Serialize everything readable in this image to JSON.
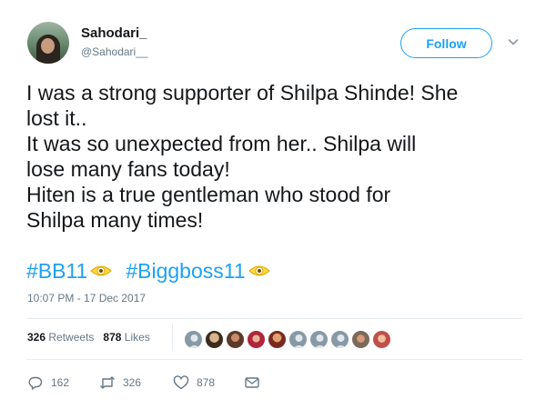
{
  "user": {
    "name": "Sahodari_",
    "handle": "@Sahodari__"
  },
  "follow_label": "Follow",
  "tweet": {
    "lines": [
      "I was a strong supporter of Shilpa Shinde! She",
      "lost it..",
      "It was so unexpected from her.. Shilpa will",
      "lose many fans today!",
      "Hiten is a true gentleman who stood for",
      "Shilpa many times!"
    ],
    "hashtags": [
      "#BB11",
      "#Biggboss11"
    ]
  },
  "timestamp": "10:07 PM - 17 Dec 2017",
  "stats": {
    "retweets_count": "326",
    "retweets_label": "Retweets",
    "likes_count": "878",
    "likes_label": "Likes"
  },
  "actions": {
    "replies": "162",
    "retweets": "326",
    "likes": "878"
  },
  "colors": {
    "accent": "#1da1f2",
    "secondary_text": "#657786",
    "divider": "#e6ecf0"
  },
  "icons": {
    "more": "chevron-down-icon",
    "reply": "reply-icon",
    "retweet": "retweet-icon",
    "like": "heart-icon",
    "message": "envelope-icon",
    "hashtag_emoji": "eye-emoji-icon"
  }
}
